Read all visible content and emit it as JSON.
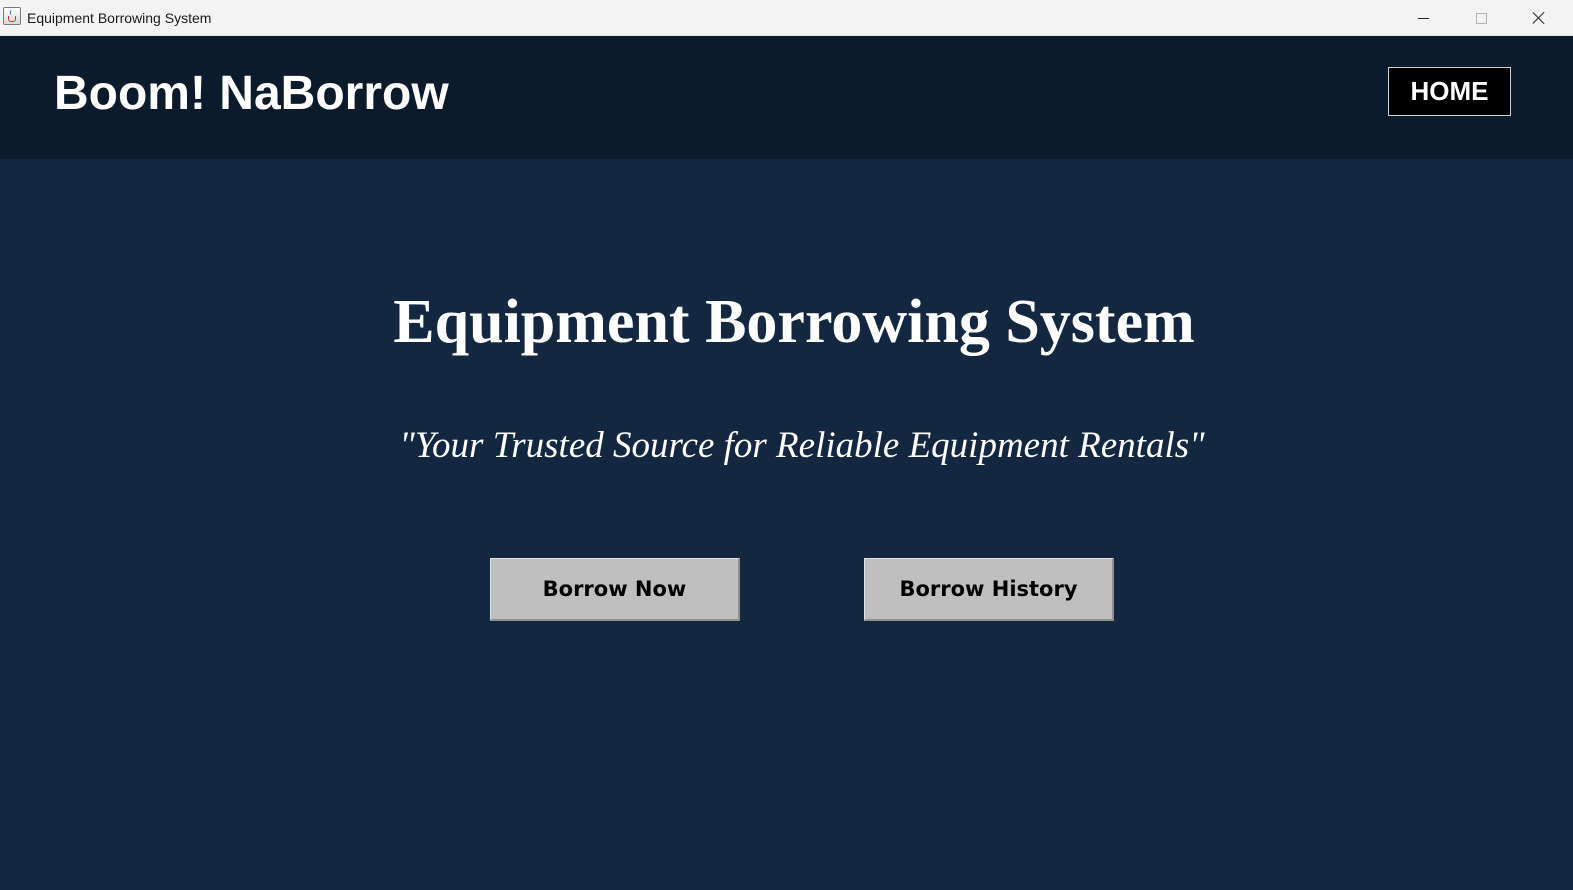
{
  "window": {
    "title": "Equipment Borrowing System",
    "icon": "java-cup-icon"
  },
  "header": {
    "brand": "Boom! NaBorrow",
    "home_label": "HOME"
  },
  "main": {
    "headline": "Equipment Borrowing System",
    "tagline": "\"Your Trusted Source for Reliable Equipment Rentals\"",
    "borrow_now_label": "Borrow Now",
    "borrow_history_label": "Borrow History"
  },
  "colors": {
    "header_background": "#0c1b2b",
    "main_background": "#132840",
    "button_background": "#bfbfbf",
    "home_button_background": "#000000"
  }
}
